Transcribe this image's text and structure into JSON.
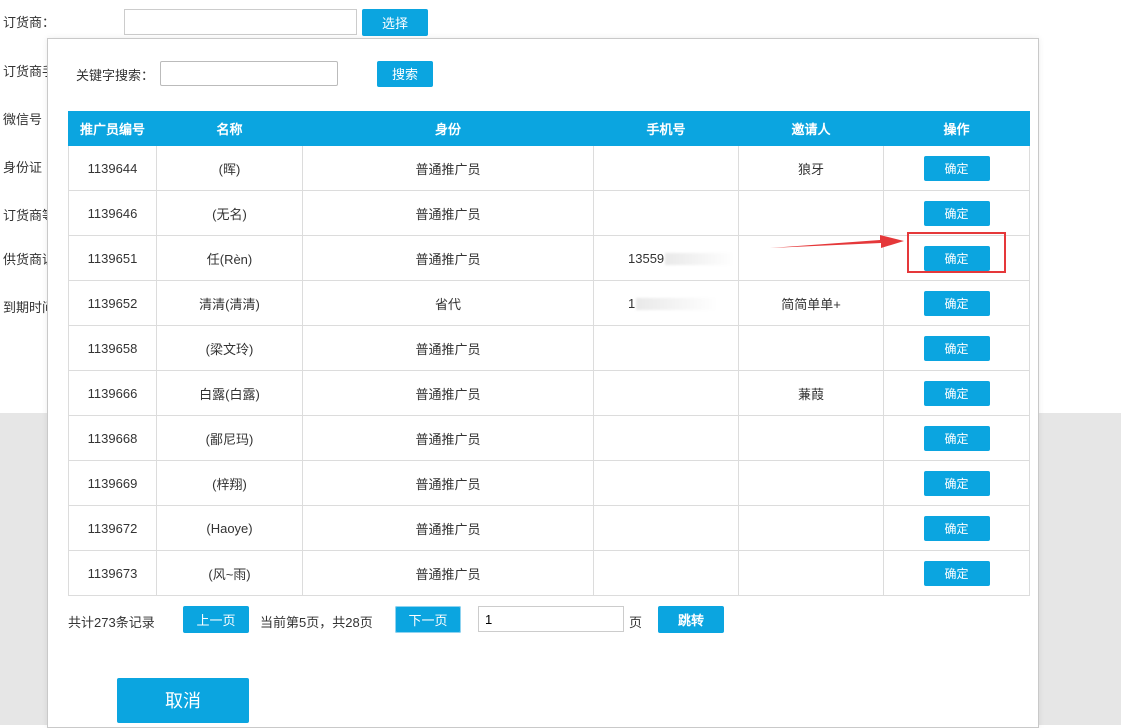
{
  "background": {
    "labels": [
      "订货商：",
      "订货商手",
      "微信号",
      "身份证",
      "订货商等",
      "供货商证",
      "到期时间"
    ],
    "select_button": "选择"
  },
  "modal": {
    "keyword_label": "关键字搜索：",
    "keyword_value": "",
    "search_button": "搜索",
    "table": {
      "headers": [
        "推广员编号",
        "名称",
        "身份",
        "手机号",
        "邀请人",
        "操作"
      ],
      "rows": [
        {
          "id": "1139644",
          "name": "(晖)",
          "role": "普通推广员",
          "phone": "",
          "inviter": "狼牙",
          "action": "确定"
        },
        {
          "id": "1139646",
          "name": "(无名)",
          "role": "普通推广员",
          "phone": "",
          "inviter": "",
          "action": "确定"
        },
        {
          "id": "1139651",
          "name": "任(Rèn)",
          "role": "普通推广员",
          "phone": "13559",
          "inviter": "",
          "action": "确定"
        },
        {
          "id": "1139652",
          "name": "清清(清清)",
          "role": "省代",
          "phone": "1",
          "inviter": "简简单单+",
          "action": "确定"
        },
        {
          "id": "1139658",
          "name": "(梁文玲)",
          "role": "普通推广员",
          "phone": "",
          "inviter": "",
          "action": "确定"
        },
        {
          "id": "1139666",
          "name": "白露(白露)",
          "role": "普通推广员",
          "phone": "",
          "inviter": "蒹葭",
          "action": "确定"
        },
        {
          "id": "1139668",
          "name": "(鄙尼玛)",
          "role": "普通推广员",
          "phone": "",
          "inviter": "",
          "action": "确定"
        },
        {
          "id": "1139669",
          "name": "(梓翔)",
          "role": "普通推广员",
          "phone": "",
          "inviter": "",
          "action": "确定"
        },
        {
          "id": "1139672",
          "name": "(Haoye)",
          "role": "普通推广员",
          "phone": "",
          "inviter": "",
          "action": "确定"
        },
        {
          "id": "1139673",
          "name": "(风~雨)",
          "role": "普通推广员",
          "phone": "",
          "inviter": "",
          "action": "确定"
        }
      ]
    },
    "pager": {
      "total": "共计273条记录",
      "prev": "上一页",
      "info": "当前第5页，共28页",
      "next": "下一页",
      "page_input": "1",
      "unit": "页",
      "go": "跳转"
    },
    "cancel": "取消"
  },
  "colors": {
    "accent": "#0ba5e0",
    "highlight": "#e5383a"
  }
}
